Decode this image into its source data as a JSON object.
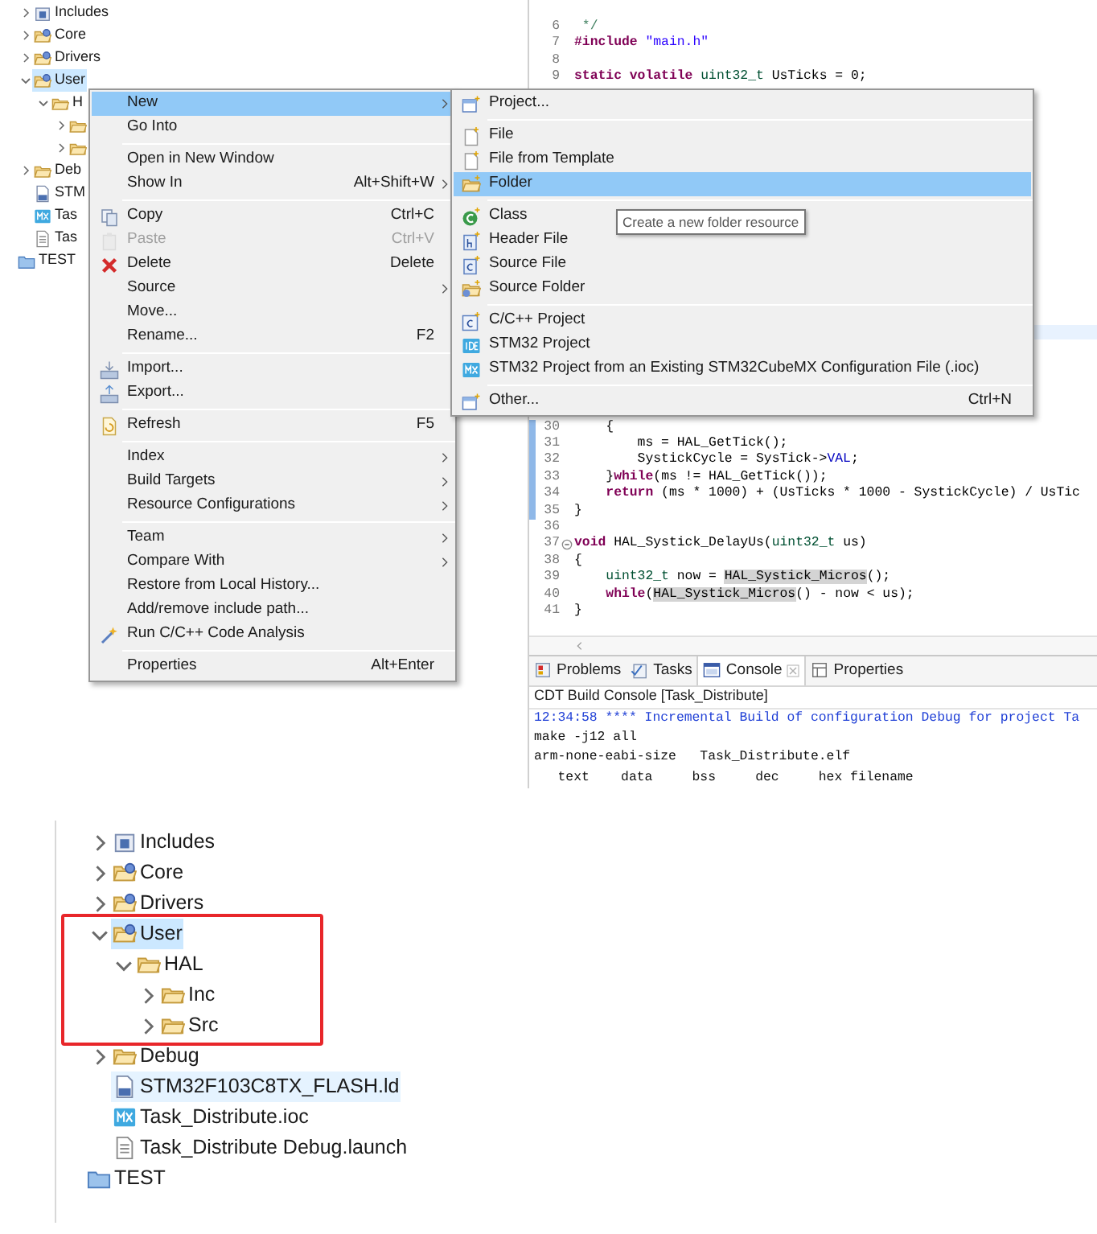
{
  "top_view": {
    "project_tree": [
      {
        "label": "Includes",
        "kind": "includes",
        "expanded": false,
        "selected": false
      },
      {
        "label": "Core",
        "kind": "source-folder",
        "expanded": false,
        "selected": false
      },
      {
        "label": "Drivers",
        "kind": "source-folder",
        "expanded": false,
        "selected": false
      },
      {
        "label": "User",
        "kind": "source-folder",
        "expanded": true,
        "selected": true,
        "children": [
          {
            "label": "H",
            "kind": "folder",
            "expanded": true,
            "selected": false,
            "children": [
              {
                "kind": "folder",
                "expanded": false,
                "selected": false
              },
              {
                "kind": "folder",
                "expanded": false,
                "selected": false
              }
            ]
          }
        ]
      },
      {
        "label": "Deb",
        "kind": "folder",
        "expanded": false,
        "selected": false
      },
      {
        "label": "STM",
        "kind": "linker",
        "selected": false
      },
      {
        "label": "Tas",
        "kind": "mx",
        "selected": false
      },
      {
        "label": "Tas",
        "kind": "file",
        "selected": false
      },
      {
        "label": "TEST",
        "kind": "project",
        "selected": false
      }
    ],
    "editor": {
      "top_lines": [
        {
          "number": "6",
          "changed": false,
          "fold": false,
          "tokens": [
            {
              "text": " */",
              "kind": "comment"
            }
          ]
        },
        {
          "number": "7",
          "changed": false,
          "fold": false,
          "tokens": [
            {
              "text": "#include",
              "kind": "keyword"
            },
            {
              "text": " \"main.h\"",
              "kind": "string"
            }
          ]
        },
        {
          "number": "8",
          "changed": false,
          "fold": false
        },
        {
          "number": "9",
          "changed": false,
          "fold": false,
          "tokens": [
            {
              "text": "static volatile",
              "kind": "keyword"
            },
            {
              "text": " uint32_t",
              "kind": "type"
            },
            {
              "text": " UsTicks = 0;",
              "kind": "plain"
            }
          ]
        }
      ],
      "bottom_lines": [
        {
          "number": "30",
          "changed": true,
          "fold": false,
          "tokens": [
            {
              "text": "    {",
              "kind": "plain"
            }
          ]
        },
        {
          "number": "31",
          "changed": true,
          "fold": false,
          "tokens": [
            {
              "text": "        ms = HAL_GetTick();",
              "kind": "plain"
            }
          ]
        },
        {
          "number": "32",
          "changed": true,
          "fold": false,
          "tokens": [
            {
              "text": "        SystickCycle = SysTick->",
              "kind": "plain"
            },
            {
              "text": "VAL",
              "kind": "field"
            },
            {
              "text": ";",
              "kind": "plain"
            }
          ]
        },
        {
          "number": "33",
          "changed": true,
          "fold": false,
          "tokens": [
            {
              "text": "    }",
              "kind": "plain"
            },
            {
              "text": "while",
              "kind": "keyword"
            },
            {
              "text": "(ms != HAL_GetTick());",
              "kind": "plain"
            }
          ]
        },
        {
          "number": "34",
          "changed": true,
          "fold": false,
          "tokens": [
            {
              "text": "    return",
              "kind": "keyword"
            },
            {
              "text": " (ms * 1000) + (UsTicks * 1000 - SystickCycle) / UsTic",
              "kind": "plain"
            }
          ]
        },
        {
          "number": "35",
          "changed": true,
          "fold": false,
          "tokens": [
            {
              "text": "}",
              "kind": "plain"
            }
          ]
        },
        {
          "number": "36",
          "changed": false,
          "fold": false
        },
        {
          "number": "37",
          "changed": false,
          "fold": true,
          "tokens": [
            {
              "text": "void",
              "kind": "keyword"
            },
            {
              "text": " HAL_Systick_DelayUs(",
              "kind": "plain"
            },
            {
              "text": "uint32_t",
              "kind": "type"
            },
            {
              "text": " us)",
              "kind": "plain"
            }
          ]
        },
        {
          "number": "38",
          "changed": false,
          "fold": false,
          "tokens": [
            {
              "text": "{",
              "kind": "plain"
            }
          ]
        },
        {
          "number": "39",
          "changed": false,
          "fold": false,
          "tokens": [
            {
              "text": "    uint32_t",
              "kind": "type"
            },
            {
              "text": " now = ",
              "kind": "plain"
            },
            {
              "text": "HAL_Systick_Micros",
              "kind": "occurrence"
            },
            {
              "text": "();",
              "kind": "plain"
            }
          ]
        },
        {
          "number": "40",
          "changed": false,
          "fold": false,
          "tokens": [
            {
              "text": "    while",
              "kind": "keyword"
            },
            {
              "text": "(",
              "kind": "plain"
            },
            {
              "text": "HAL_Systick_Micros",
              "kind": "occurrence"
            },
            {
              "text": "() - now < us);",
              "kind": "plain"
            }
          ]
        },
        {
          "number": "41",
          "changed": false,
          "fold": false,
          "tokens": [
            {
              "text": "}",
              "kind": "plain"
            }
          ]
        }
      ]
    },
    "console": {
      "tabs": [
        {
          "label": "Problems",
          "selected": false
        },
        {
          "label": "Tasks",
          "selected": false
        },
        {
          "label": "Console",
          "selected": true
        },
        {
          "label": "Properties",
          "selected": false
        }
      ],
      "title": "CDT Build Console [Task_Distribute]",
      "lines": [
        {
          "text": "12:34:58 **** Incremental Build of configuration Debug for project Ta",
          "kind": "info"
        },
        {
          "text": "make -j12 all",
          "kind": "plain"
        },
        {
          "text": "arm-none-eabi-size   Task_Distribute.elf",
          "kind": "plain"
        },
        {
          "text": "   text    data     bss     dec     hex filename",
          "kind": "plain"
        }
      ]
    },
    "context_menu": {
      "items": [
        {
          "kind": "item",
          "label": "New",
          "selected": true,
          "submenu": true,
          "disabled": false
        },
        {
          "kind": "item",
          "label": "Go Into",
          "selected": false,
          "submenu": false,
          "disabled": false
        },
        {
          "kind": "separator"
        },
        {
          "kind": "item",
          "label": "Open in New Window",
          "selected": false,
          "submenu": false,
          "disabled": false
        },
        {
          "kind": "item",
          "label": "Show In",
          "shortcut": "Alt+Shift+W",
          "selected": false,
          "submenu": true,
          "disabled": false
        },
        {
          "kind": "separator"
        },
        {
          "kind": "item",
          "label": "Copy",
          "shortcut": "Ctrl+C",
          "selected": false,
          "submenu": false,
          "disabled": false
        },
        {
          "kind": "item",
          "label": "Paste",
          "shortcut": "Ctrl+V",
          "selected": false,
          "submenu": false,
          "disabled": true
        },
        {
          "kind": "item",
          "label": "Delete",
          "shortcut": "Delete",
          "selected": false,
          "submenu": false,
          "disabled": false
        },
        {
          "kind": "item",
          "label": "Source",
          "selected": false,
          "submenu": true,
          "disabled": false
        },
        {
          "kind": "item",
          "label": "Move...",
          "selected": false,
          "submenu": false,
          "disabled": false
        },
        {
          "kind": "item",
          "label": "Rename...",
          "shortcut": "F2",
          "selected": false,
          "submenu": false,
          "disabled": false
        },
        {
          "kind": "separator"
        },
        {
          "kind": "item",
          "label": "Import...",
          "selected": false,
          "submenu": false,
          "disabled": false
        },
        {
          "kind": "item",
          "label": "Export...",
          "selected": false,
          "submenu": false,
          "disabled": false
        },
        {
          "kind": "separator"
        },
        {
          "kind": "item",
          "label": "Refresh",
          "shortcut": "F5",
          "selected": false,
          "submenu": false,
          "disabled": false
        },
        {
          "kind": "separator"
        },
        {
          "kind": "item",
          "label": "Index",
          "selected": false,
          "submenu": true,
          "disabled": false
        },
        {
          "kind": "item",
          "label": "Build Targets",
          "selected": false,
          "submenu": true,
          "disabled": false
        },
        {
          "kind": "item",
          "label": "Resource Configurations",
          "selected": false,
          "submenu": true,
          "disabled": false
        },
        {
          "kind": "separator"
        },
        {
          "kind": "item",
          "label": "Team",
          "selected": false,
          "submenu": true,
          "disabled": false
        },
        {
          "kind": "item",
          "label": "Compare With",
          "selected": false,
          "submenu": true,
          "disabled": false
        },
        {
          "kind": "item",
          "label": "Restore from Local History...",
          "selected": false,
          "submenu": false,
          "disabled": false
        },
        {
          "kind": "item",
          "label": "Add/remove include path...",
          "selected": false,
          "submenu": false,
          "disabled": false
        },
        {
          "kind": "item",
          "label": "Run C/C++ Code Analysis",
          "selected": false,
          "submenu": false,
          "disabled": false
        },
        {
          "kind": "separator"
        },
        {
          "kind": "item",
          "label": "Properties",
          "shortcut": "Alt+Enter",
          "selected": false,
          "submenu": false,
          "disabled": false
        }
      ]
    },
    "new_submenu": {
      "items": [
        {
          "kind": "item",
          "label": "Project...",
          "selected": false
        },
        {
          "kind": "separator"
        },
        {
          "kind": "item",
          "label": "File",
          "selected": false
        },
        {
          "kind": "item",
          "label": "File from Template",
          "selected": false
        },
        {
          "kind": "item",
          "label": "Folder",
          "selected": true
        },
        {
          "kind": "separator"
        },
        {
          "kind": "item",
          "label": "Class",
          "selected": false
        },
        {
          "kind": "item",
          "label": "Header File",
          "selected": false
        },
        {
          "kind": "item",
          "label": "Source File",
          "selected": false
        },
        {
          "kind": "item",
          "label": "Source Folder",
          "selected": false
        },
        {
          "kind": "separator"
        },
        {
          "kind": "item",
          "label": "C/C++ Project",
          "selected": false
        },
        {
          "kind": "item",
          "label": "STM32 Project",
          "selected": false
        },
        {
          "kind": "item",
          "label": "STM32 Project from an Existing STM32CubeMX Configuration File (.ioc)",
          "selected": false
        },
        {
          "kind": "separator"
        },
        {
          "kind": "item",
          "label": "Other...",
          "shortcut": "Ctrl+N",
          "selected": false
        }
      ]
    },
    "tooltip": "Create a new folder resource"
  },
  "bottom_view": {
    "project_tree": [
      {
        "label": "Includes",
        "kind": "includes",
        "expanded": false,
        "selected": false
      },
      {
        "label": "Core",
        "kind": "source-folder",
        "expanded": false,
        "selected": false
      },
      {
        "label": "Drivers",
        "kind": "source-folder",
        "expanded": false,
        "selected": false
      },
      {
        "label": "User",
        "kind": "source-folder",
        "expanded": true,
        "selected": true,
        "children": [
          {
            "label": "HAL",
            "kind": "folder",
            "expanded": true,
            "selected": false,
            "children": [
              {
                "label": "Inc",
                "kind": "folder",
                "expanded": false,
                "selected": false
              },
              {
                "label": "Src",
                "kind": "folder",
                "expanded": false,
                "selected": false
              }
            ]
          }
        ]
      },
      {
        "label": "Debug",
        "kind": "folder",
        "expanded": false,
        "selected": false
      },
      {
        "label": "STM32F103C8TX_FLASH.ld",
        "kind": "linker",
        "selected": false,
        "highlighted": true
      },
      {
        "label": "Task_Distribute.ioc",
        "kind": "mx",
        "selected": false
      },
      {
        "label": "Task_Distribute Debug.launch",
        "kind": "file",
        "selected": false
      },
      {
        "label": "TEST",
        "kind": "project",
        "selected": false
      }
    ]
  }
}
